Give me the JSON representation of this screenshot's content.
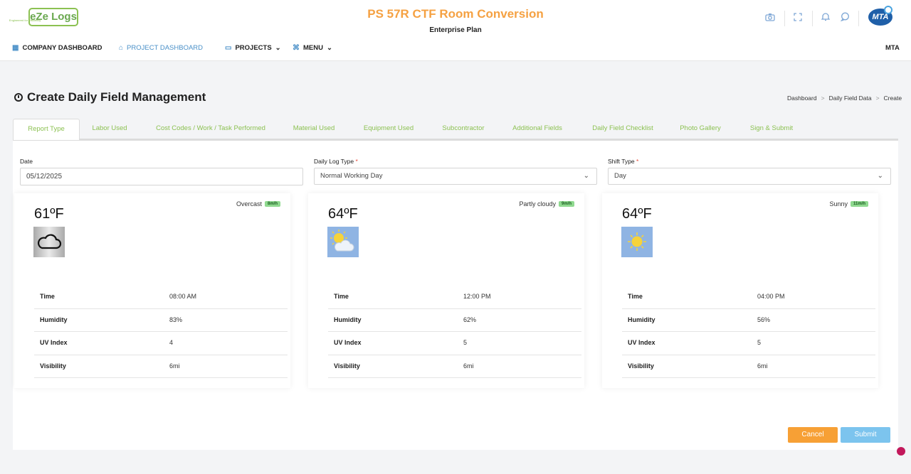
{
  "header": {
    "logo_text": "eZe Logs",
    "logo_tagline": "Engineered for Efficiency",
    "project_title": "PS 57R CTF Room Conversion",
    "plan": "Enterprise Plan",
    "icons": [
      "camera-icon",
      "fullscreen-icon",
      "bell-icon",
      "chat-icon"
    ],
    "avatar_text": "MTA",
    "brand_color": "#f5a142",
    "accent_color": "#8cc152"
  },
  "nav": {
    "company_dashboard": "COMPANY DASHBOARD",
    "project_dashboard": "PROJECT DASHBOARD",
    "projects": "PROJECTS",
    "menu": "MENU",
    "user": "MTA"
  },
  "page": {
    "title": "Create Daily Field Management",
    "breadcrumb": [
      "Dashboard",
      "Daily Field Data",
      "Create"
    ],
    "breadcrumb_sep": ">"
  },
  "tabs": [
    "Report Type",
    "Labor Used",
    "Cost Codes / Work / Task Performed",
    "Material Used",
    "Equipment Used",
    "Subcontractor",
    "Additional Fields",
    "Daily Field Checklist",
    "Photo Gallery",
    "Sign & Submit"
  ],
  "form": {
    "date_label": "Date",
    "date_value": "05/12/2025",
    "log_type_label": "Daily Log Type",
    "log_type_value": "Normal Working Day",
    "shift_label": "Shift Type",
    "shift_value": "Day",
    "required_mark": "*"
  },
  "weather": [
    {
      "temp": "61ºF",
      "condition": "Overcast",
      "wind": "8m/h",
      "icon": "cloud-icon",
      "rows": [
        [
          "Time",
          "08:00 AM"
        ],
        [
          "Humidity",
          "83%"
        ],
        [
          "UV Index",
          "4"
        ],
        [
          "Visibility",
          "6mi"
        ]
      ]
    },
    {
      "temp": "64ºF",
      "condition": "Partly cloudy",
      "wind": "9m/h",
      "icon": "partly-cloudy-icon",
      "rows": [
        [
          "Time",
          "12:00 PM"
        ],
        [
          "Humidity",
          "62%"
        ],
        [
          "UV Index",
          "5"
        ],
        [
          "Visibility",
          "6mi"
        ]
      ]
    },
    {
      "temp": "64ºF",
      "condition": "Sunny",
      "wind": "11m/h",
      "icon": "sun-icon",
      "rows": [
        [
          "Time",
          "04:00 PM"
        ],
        [
          "Humidity",
          "56%"
        ],
        [
          "UV Index",
          "5"
        ],
        [
          "Visibility",
          "6mi"
        ]
      ]
    }
  ],
  "actions": {
    "cancel": "Cancel",
    "submit": "Submit",
    "cancel_color": "#f7a035",
    "submit_color": "#7cc4ee"
  }
}
